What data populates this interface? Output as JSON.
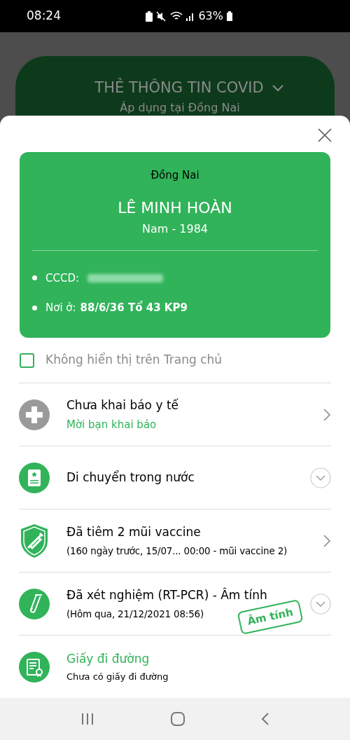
{
  "status_bar": {
    "time": "08:24",
    "battery": "63%"
  },
  "background_card": {
    "title": "THẺ THÔNG TIN COVID",
    "subtitle": "Áp dụng tại Đồng Nai"
  },
  "card": {
    "province": "Đồng Nai",
    "name": "LÊ MINH HOÀN",
    "gender_year": "Nam - 1984",
    "fields": [
      {
        "kind": "redacted",
        "label": "CCCD:"
      },
      {
        "kind": "text",
        "label": "Nơi ở:",
        "value": "88/6/36 Tổ 43 KP9"
      }
    ]
  },
  "hide_option": {
    "label": "Không hiển thị trên Trang chủ",
    "checked": false
  },
  "items": [
    {
      "kind": "declaration",
      "title": "Chưa khai báo y tế",
      "subtitle": "Mời bạn khai báo"
    },
    {
      "kind": "domestic",
      "title": "Di chuyển trong nước"
    },
    {
      "kind": "vaccine",
      "title": "Đã tiêm 2 mũi vaccine",
      "subtitle": "(160 ngày trước, 15/07... 00:00 - mũi vaccine 2)"
    },
    {
      "kind": "test",
      "title": "Đã xét nghiệm (RT-PCR) - Âm tính",
      "subtitle": "(Hôm qua, 21/12/2021 08:56)",
      "stamp": "Âm tính"
    },
    {
      "kind": "travel_paper",
      "title": "Giấy đi đường",
      "subtitle": "Chưa có giấy đi đường"
    }
  ]
}
